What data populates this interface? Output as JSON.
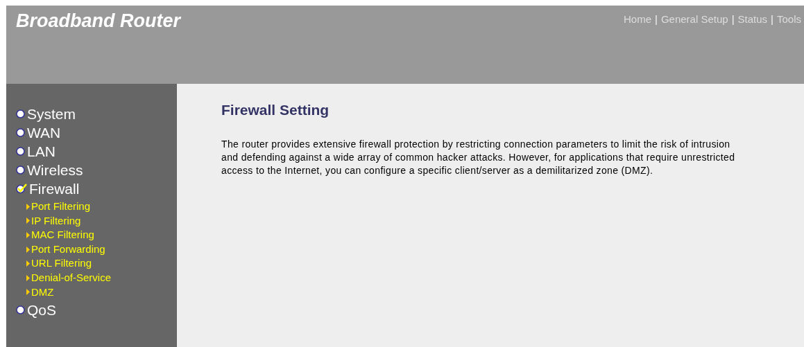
{
  "header": {
    "title": "Broadband Router",
    "nav": [
      {
        "kind": "link",
        "label": "Home"
      },
      {
        "kind": "separator",
        "label": "|"
      },
      {
        "kind": "link",
        "label": "General Setup"
      },
      {
        "kind": "separator",
        "label": "|"
      },
      {
        "kind": "link",
        "label": "Status"
      },
      {
        "kind": "separator",
        "label": "|"
      },
      {
        "kind": "link",
        "label": "Tools"
      }
    ]
  },
  "sidebar": {
    "items": [
      {
        "label": "System",
        "selected": false
      },
      {
        "label": "WAN",
        "selected": false
      },
      {
        "label": "LAN",
        "selected": false
      },
      {
        "label": "Wireless",
        "selected": false
      },
      {
        "label": "Firewall",
        "selected": true,
        "children": [
          {
            "label": "Port Filtering"
          },
          {
            "label": "IP Filtering"
          },
          {
            "label": "MAC Filtering"
          },
          {
            "label": "Port Forwarding"
          },
          {
            "label": "URL Filtering"
          },
          {
            "label": "Denial-of-Service"
          },
          {
            "label": "DMZ"
          }
        ]
      },
      {
        "label": "QoS",
        "selected": false
      }
    ]
  },
  "content": {
    "heading": "Firewall Setting",
    "description": "The router provides extensive firewall protection by restricting connection parameters to limit the risk of intrusion and defending against a wide array of common hacker attacks. However, for applications that require unrestricted access to the Internet, you can configure a specific client/server as a demilitarized zone (DMZ)."
  }
}
